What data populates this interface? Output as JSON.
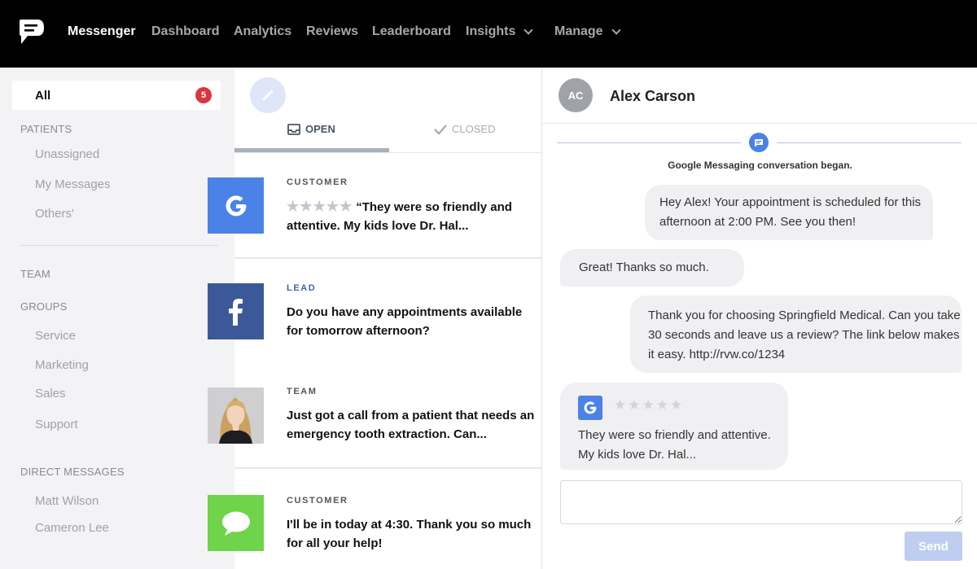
{
  "nav": {
    "items": [
      {
        "label": "Messenger"
      },
      {
        "label": "Dashboard"
      },
      {
        "label": "Analytics"
      },
      {
        "label": "Reviews"
      },
      {
        "label": "Leaderboard"
      },
      {
        "label": "Insights"
      },
      {
        "label": "Manage"
      }
    ]
  },
  "sidebar": {
    "all_label": "All",
    "all_count": "5",
    "patients_heading": "PATIENTS",
    "patients_items": [
      {
        "label": "Unassigned"
      },
      {
        "label": "My Messages"
      },
      {
        "label": "Others'"
      }
    ],
    "team_heading": "TEAM",
    "groups_heading": "GROUPS",
    "groups_items": [
      {
        "label": "Service"
      },
      {
        "label": "Marketing"
      },
      {
        "label": "Sales"
      },
      {
        "label": "Support"
      }
    ],
    "dm_heading": "DIRECT MESSAGES",
    "dm_items": [
      {
        "label": "Matt Wilson"
      },
      {
        "label": "Cameron Lee"
      }
    ]
  },
  "convlist": {
    "tabs": {
      "open": "OPEN",
      "closed": "CLOSED"
    },
    "conversations": [
      {
        "tag": "CUSTOMER",
        "rating_stars": 5,
        "text": "“They were so friendly and attentive. My kids love Dr. Hal...",
        "source_icon": "google-icon"
      },
      {
        "tag": "LEAD",
        "text": "Do you have any appointments available for tomorrow afternoon?",
        "source_icon": "facebook-icon"
      },
      {
        "tag": "TEAM",
        "text": "Just got a call from a patient that needs an emergency tooth extraction. Can...",
        "source_icon": "team-member-photo"
      },
      {
        "tag": "CUSTOMER",
        "text": "I'll be in today at 4:30. Thank you so much for all your help!",
        "source_icon": "sms-icon"
      }
    ]
  },
  "chat": {
    "initials": "AC",
    "name": "Alex Carson",
    "system_text": "Google Messaging conversation began.",
    "messages": [
      {
        "text": "Hey Alex! Your appointment is scheduled for this afternoon at 2:00 PM. See you then!"
      },
      {
        "text": "Great! Thanks so much."
      },
      {
        "text": "Thank you for choosing Springfield Medical. Can you take 30 seconds and leave us a review? The link below makes it easy. http://rvw.co/1234"
      },
      {
        "text": "They were so friendly and attentive. My kids love Dr. Hal...",
        "rating_stars": 5
      }
    ],
    "input_placeholder": "",
    "send_label": "Send"
  },
  "colors": {
    "accent_blue": "#4a82e8",
    "badge_red": "#d9363e",
    "facebook_blue": "#3b5998",
    "sms_green": "#6fd449"
  }
}
